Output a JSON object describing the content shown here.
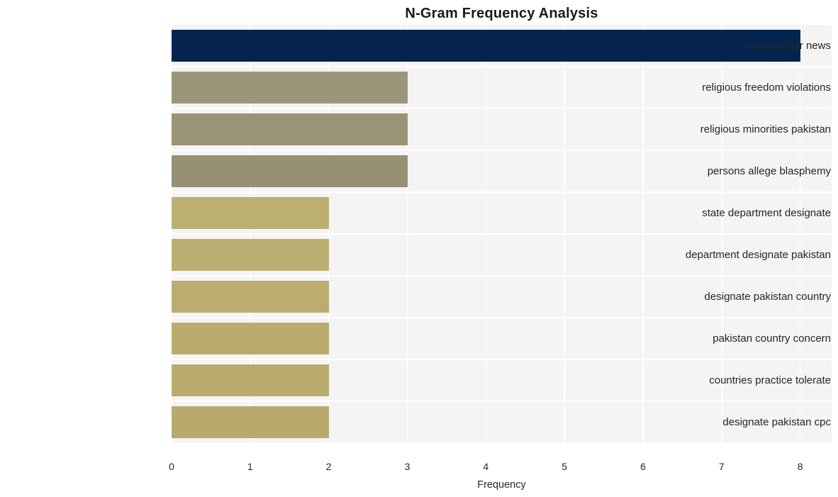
{
  "chart_data": {
    "type": "bar",
    "orientation": "horizontal",
    "title": "N-Gram Frequency Analysis",
    "xlabel": "Frequency",
    "ylabel": "",
    "xlim": [
      0,
      8.4
    ],
    "xticks": [
      "0",
      "1",
      "2",
      "3",
      "4",
      "5",
      "6",
      "7",
      "8"
    ],
    "xtick_values": [
      0,
      1,
      2,
      3,
      4,
      5,
      6,
      7,
      8
    ],
    "grid": true,
    "legend": null,
    "categories": [
      "morning star news",
      "religious freedom violations",
      "religious minorities pakistan",
      "persons allege blasphemy",
      "state department designate",
      "department designate pakistan",
      "designate pakistan country",
      "pakistan country concern",
      "countries practice tolerate",
      "designate pakistan cpc"
    ],
    "values": [
      8,
      3,
      3,
      3,
      2,
      2,
      2,
      2,
      2,
      2
    ],
    "bar_colors": [
      "#04244f",
      "#9d9579",
      "#9b9376",
      "#979073",
      "#bcaf72",
      "#bbae71",
      "#bbad70",
      "#baac6f",
      "#b9ab6e",
      "#b8aa6d"
    ],
    "plot_background": "#f4f4f5",
    "gridline_color": "#ffffff",
    "text_color": "#262626",
    "title_color": "#1a1a1a"
  }
}
